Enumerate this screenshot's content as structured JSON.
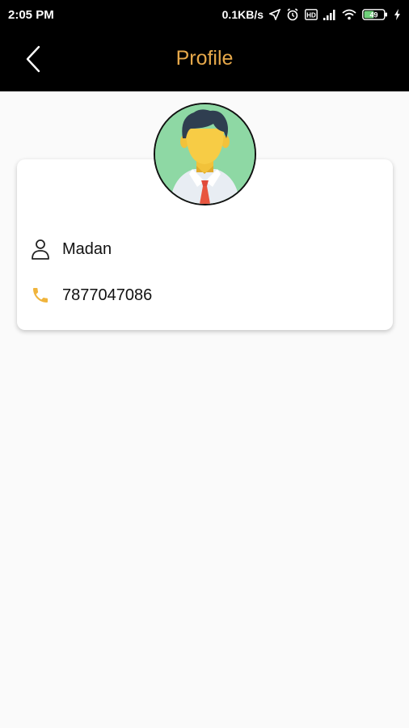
{
  "status_bar": {
    "time": "2:05 PM",
    "network_speed": "0.1KB/s",
    "battery_level": "49",
    "icons": [
      "location-arrow-icon",
      "alarm-icon",
      "hd-icon",
      "signal-icon",
      "wifi-icon",
      "battery-icon",
      "charging-icon"
    ]
  },
  "app_bar": {
    "title": "Profile",
    "back_icon": "chevron-left-icon",
    "title_color": "#e6a84a",
    "background": "#000000"
  },
  "profile": {
    "avatar": "user-avatar-icon",
    "name": "Madan",
    "name_icon": "person-icon",
    "phone": "7877047086",
    "phone_icon": "phone-icon",
    "phone_icon_color": "#f0b43c"
  }
}
